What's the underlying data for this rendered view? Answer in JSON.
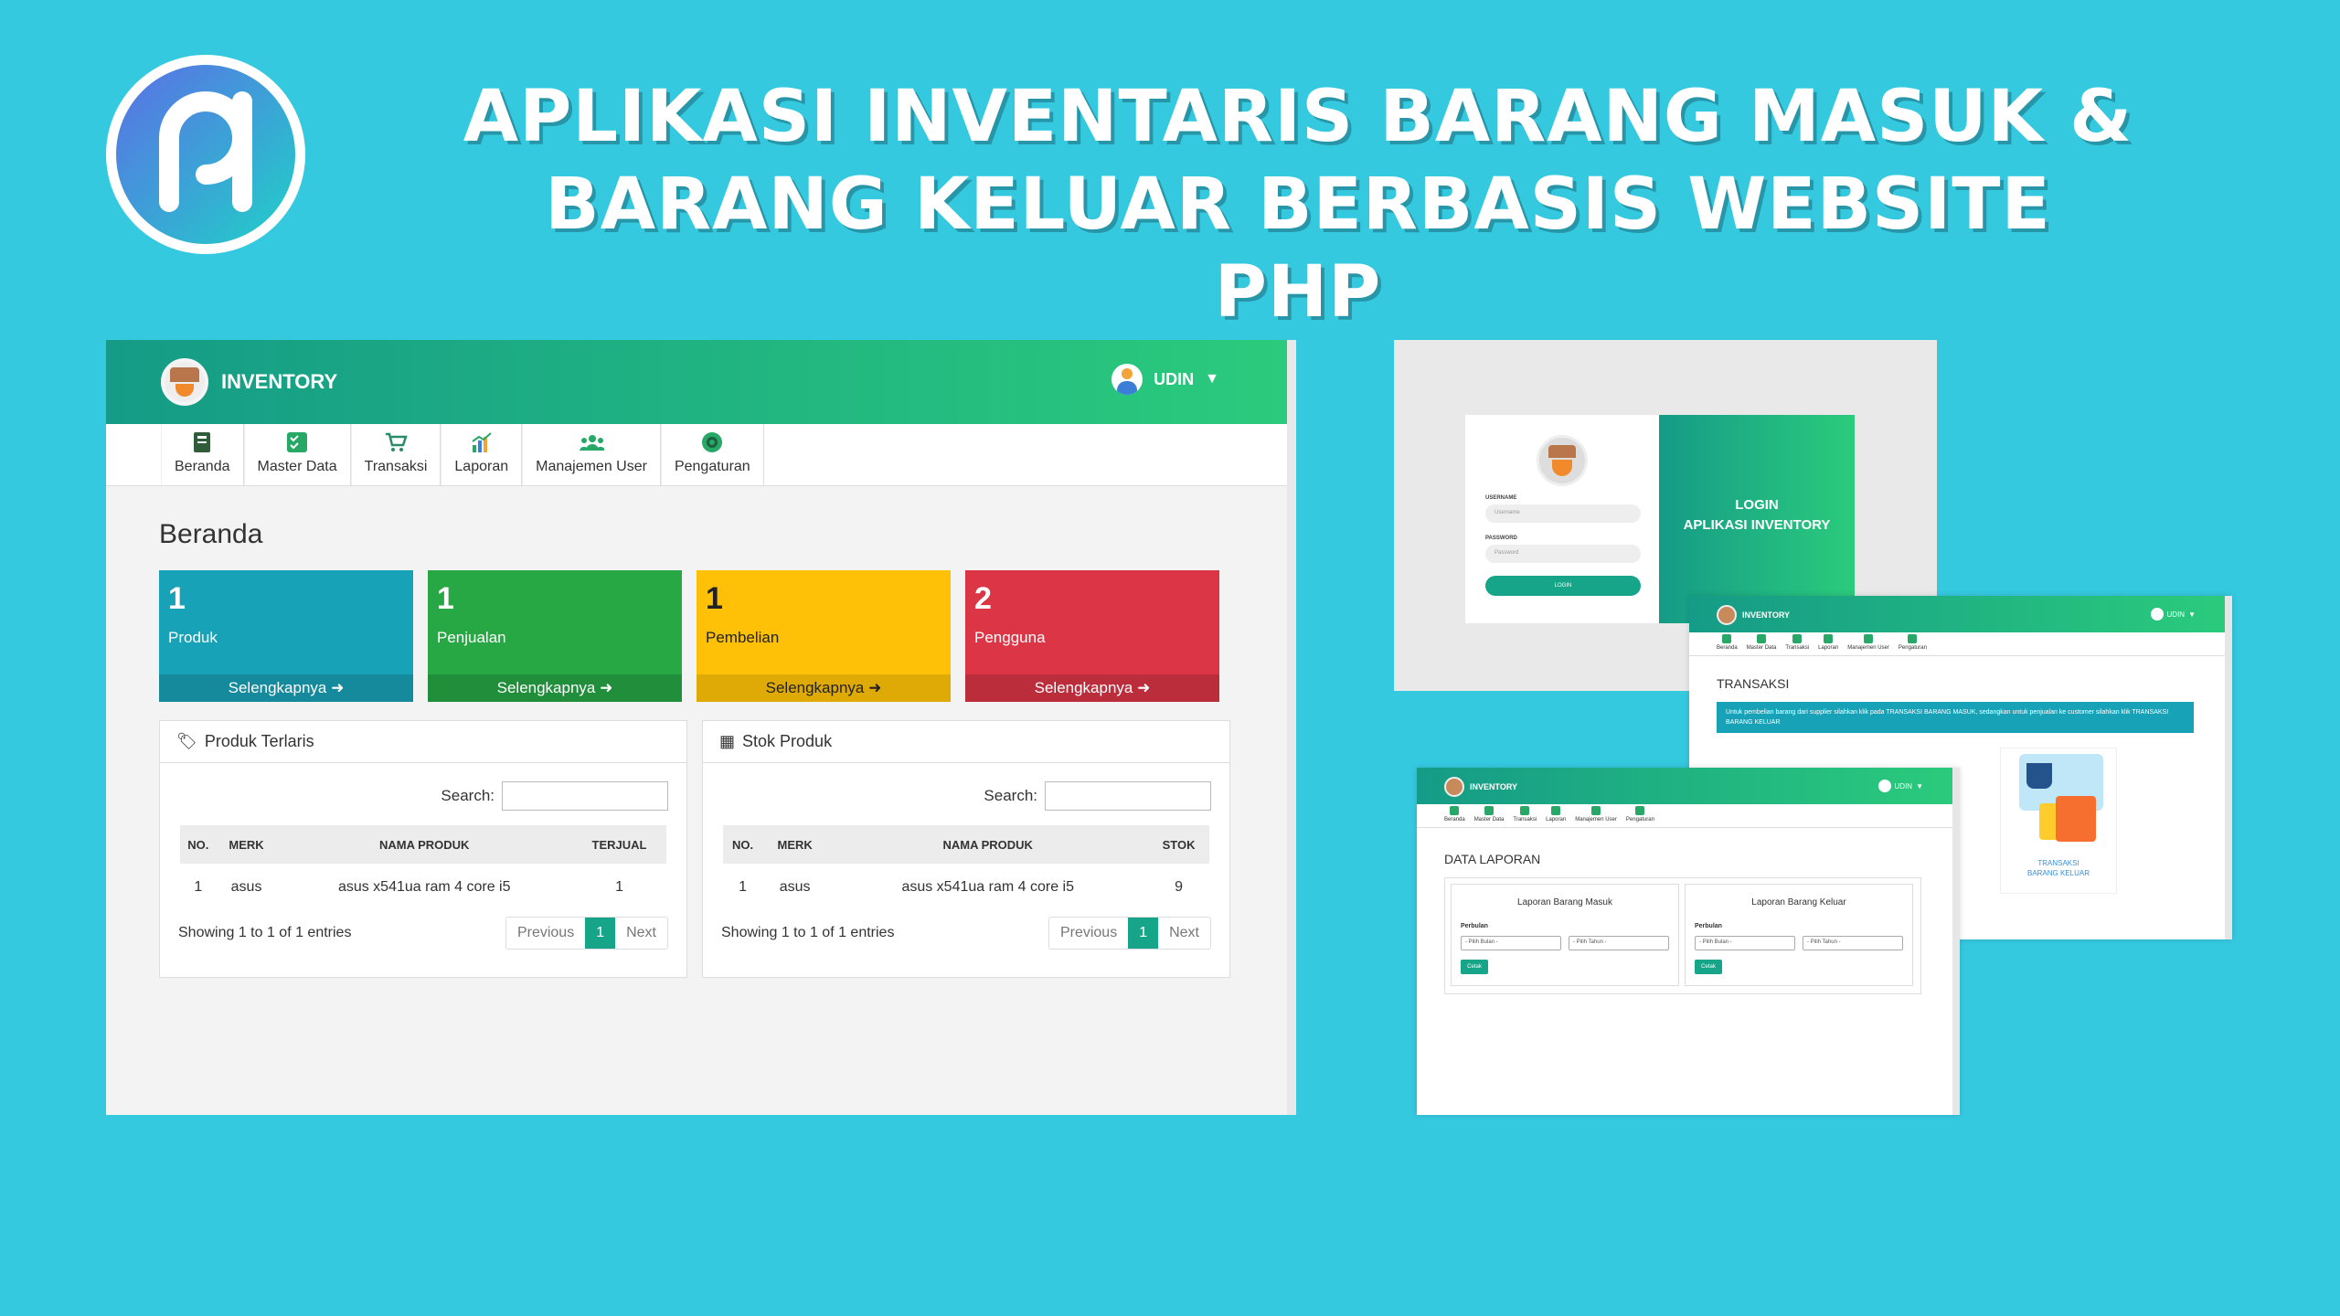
{
  "headline": {
    "line1": "APLIKASI INVENTARIS BARANG MASUK &",
    "line2": "BARANG KELUAR BERBASIS WEBSITE PHP"
  },
  "colors": {
    "background": "#35c9e0",
    "header_start": "#159b87",
    "header_end": "#2bcb7c"
  },
  "main": {
    "brand": "INVENTORY",
    "user": "UDIN",
    "nav": [
      {
        "label": "Beranda",
        "icon": "book-icon"
      },
      {
        "label": "Master Data",
        "icon": "checklist-icon"
      },
      {
        "label": "Transaksi",
        "icon": "cart-icon"
      },
      {
        "label": "Laporan",
        "icon": "chart-icon"
      },
      {
        "label": "Manajemen User",
        "icon": "users-icon"
      },
      {
        "label": "Pengaturan",
        "icon": "gear-icon"
      }
    ],
    "page_title": "Beranda",
    "cards": [
      {
        "count": "1",
        "label": "Produk",
        "link": "Selengkapnya"
      },
      {
        "count": "1",
        "label": "Penjualan",
        "link": "Selengkapnya"
      },
      {
        "count": "1",
        "label": "Pembelian",
        "link": "Selengkapnya"
      },
      {
        "count": "2",
        "label": "Pengguna",
        "link": "Selengkapnya"
      }
    ],
    "panel_left": {
      "title": "Produk Terlaris",
      "search_label": "Search:",
      "headers": [
        "NO.",
        "MERK",
        "NAMA PRODUK",
        "TERJUAL"
      ],
      "row": [
        "1",
        "asus",
        "asus x541ua ram 4 core i5",
        "1"
      ],
      "info": "Showing 1 to 1 of 1 entries",
      "prev": "Previous",
      "page": "1",
      "next": "Next"
    },
    "panel_right": {
      "title": "Stok Produk",
      "search_label": "Search:",
      "headers": [
        "NO.",
        "MERK",
        "NAMA PRODUK",
        "STOK"
      ],
      "row": [
        "1",
        "asus",
        "asus x541ua ram 4 core i5",
        "9"
      ],
      "info": "Showing 1 to 1 of 1 entries",
      "prev": "Previous",
      "page": "1",
      "next": "Next"
    }
  },
  "login": {
    "username_label": "USERNAME",
    "username_placeholder": "Username",
    "password_label": "PASSWORD",
    "password_placeholder": "Password",
    "button": "LOGIN",
    "side_line1": "LOGIN",
    "side_line2": "APLIKASI INVENTORY"
  },
  "mini": {
    "brand": "INVENTORY",
    "user": "UDIN",
    "nav": [
      "Beranda",
      "Master Data",
      "Transaksi",
      "Laporan",
      "Manajemen User",
      "Pengaturan"
    ]
  },
  "transaksi": {
    "title": "TRANSAKSI",
    "alert": "Untuk pembelian barang dari supplier silahkan klik pada TRANSAKSI BARANG MASUK, sedangkan untuk penjualan ke customer silahkan klik TRANSAKSI BARANG KELUAR",
    "card_line1": "TRANSAKSI",
    "card_line2": "BARANG KELUAR"
  },
  "laporan": {
    "title": "DATA LAPORAN",
    "masuk": "Laporan Barang Masuk",
    "keluar": "Laporan Barang Keluar",
    "periode": "Perbulan",
    "bulan": "- Pilih Bulan -",
    "tahun": "- Pilih Tahun -",
    "cetak": "Cetak"
  }
}
